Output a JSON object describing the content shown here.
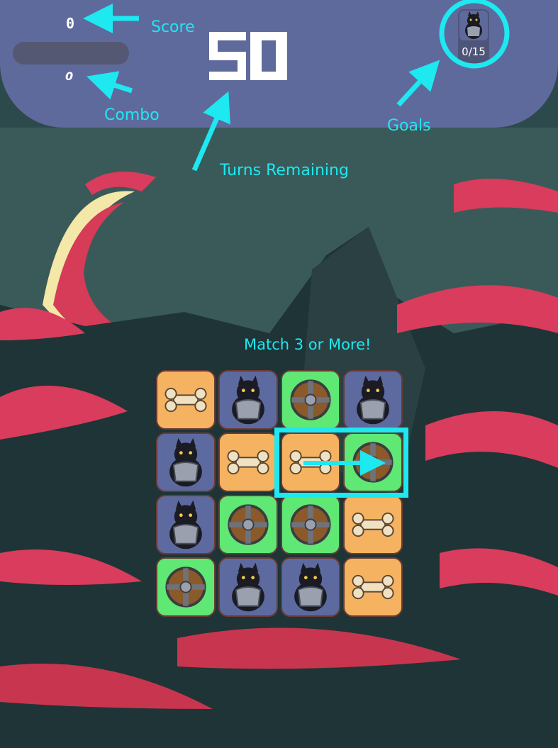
{
  "hud": {
    "score": "0",
    "combo": "0",
    "turns_remaining": "50",
    "goal": {
      "icon": "armored-dog-icon",
      "count": "0/15"
    }
  },
  "annotations": {
    "score": "Score",
    "combo": "Combo",
    "turns": "Turns Remaining",
    "goals": "Goals",
    "hint": "Match 3 or More!"
  },
  "board": {
    "rows": [
      [
        "bone",
        "dog",
        "shield",
        "dog"
      ],
      [
        "dog",
        "bone",
        "bone",
        "shield"
      ],
      [
        "dog",
        "shield",
        "shield",
        "bone"
      ],
      [
        "shield",
        "dog",
        "dog",
        "bone"
      ]
    ]
  },
  "colors": {
    "accent": "#1ee8f0",
    "hud": "#5f6a9c",
    "bone_tile": "#f5b260",
    "dog_tile": "#5d6aa0",
    "shield_tile": "#5fe874"
  }
}
